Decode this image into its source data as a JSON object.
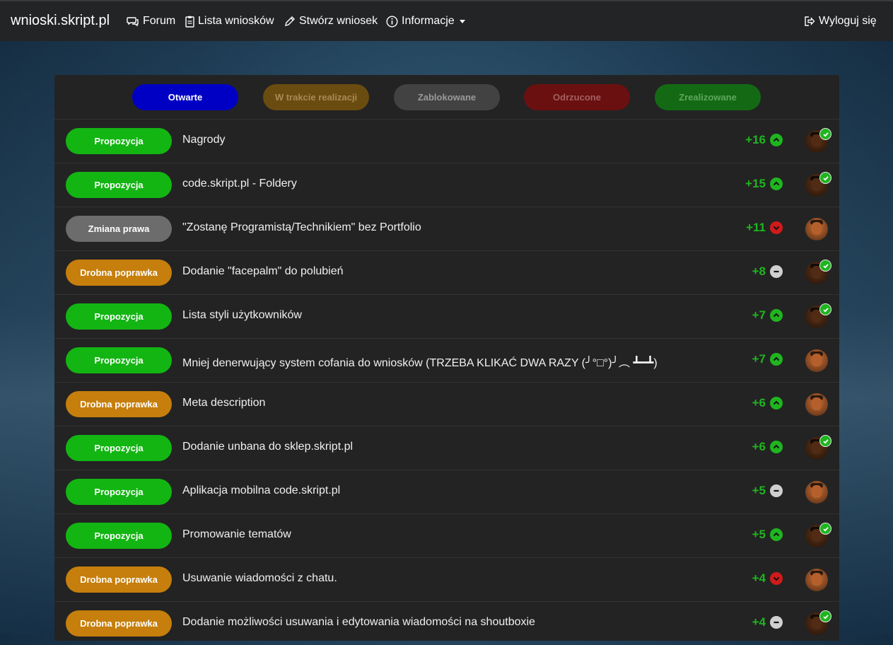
{
  "site": {
    "brand": "wnioski.skript.pl"
  },
  "nav": {
    "forum": "Forum",
    "lista": "Lista wniosków",
    "stworz": "Stwórz wniosek",
    "informacje": "Informacje",
    "logout": "Wyloguj się"
  },
  "filters": [
    {
      "label": "Otwarte",
      "bg": "#0000c4",
      "color": "#ffffff"
    },
    {
      "label": "W trakcie realizacji",
      "bg": "#6b4c10",
      "color": "#a78a55"
    },
    {
      "label": "Zablokowane",
      "bg": "#424242",
      "color": "#9a9a9a"
    },
    {
      "label": "Odrzucone",
      "bg": "#6a1010",
      "color": "#a36060"
    },
    {
      "label": "Zrealizowane",
      "bg": "#146a14",
      "color": "#5fa55f"
    }
  ],
  "colors": {
    "propozycja": "#13b513",
    "drobna": "#c67f0c",
    "zmiana": "#6c6c6c",
    "score": "#1fb51f",
    "vote_up": "#1fb51f",
    "vote_down": "#d11a1a",
    "vote_neutral": "#d0d0d0"
  },
  "requests": [
    {
      "category": "Propozycja",
      "title": "Nagrody",
      "score": "+16",
      "vote": "up",
      "accepted": true
    },
    {
      "category": "Propozycja",
      "title": "code.skript.pl - Foldery",
      "score": "+15",
      "vote": "up",
      "accepted": true
    },
    {
      "category": "Zmiana prawa",
      "title": "\"Zostanę Programistą/Technikiem\" bez Portfolio",
      "score": "+11",
      "vote": "down",
      "accepted": false
    },
    {
      "category": "Drobna poprawka",
      "title": "Dodanie \"facepalm\" do polubień",
      "score": "+8",
      "vote": "neutral",
      "accepted": true
    },
    {
      "category": "Propozycja",
      "title": "Lista styli użytkowników",
      "score": "+7",
      "vote": "up",
      "accepted": true
    },
    {
      "category": "Propozycja",
      "title": "Mniej denerwujący system cofania do wniosków (TRZEBA KLIKAĆ DWA RAZY (╯°□°)╯︵ ┻━┻)",
      "score": "+7",
      "vote": "up",
      "accepted": false
    },
    {
      "category": "Drobna poprawka",
      "title": "Meta description",
      "score": "+6",
      "vote": "up",
      "accepted": false
    },
    {
      "category": "Propozycja",
      "title": "Dodanie unbana do sklep.skript.pl",
      "score": "+6",
      "vote": "up",
      "accepted": true
    },
    {
      "category": "Propozycja",
      "title": "Aplikacja mobilna code.skript.pl",
      "score": "+5",
      "vote": "neutral",
      "accepted": false
    },
    {
      "category": "Propozycja",
      "title": "Promowanie tematów",
      "score": "+5",
      "vote": "up",
      "accepted": true
    },
    {
      "category": "Drobna poprawka",
      "title": "Usuwanie wiadomości z chatu.",
      "score": "+4",
      "vote": "down",
      "accepted": false
    },
    {
      "category": "Drobna poprawka",
      "title": "Dodanie możliwości usuwania i edytowania wiadomości na shoutboxie",
      "score": "+4",
      "vote": "neutral",
      "accepted": true
    }
  ]
}
